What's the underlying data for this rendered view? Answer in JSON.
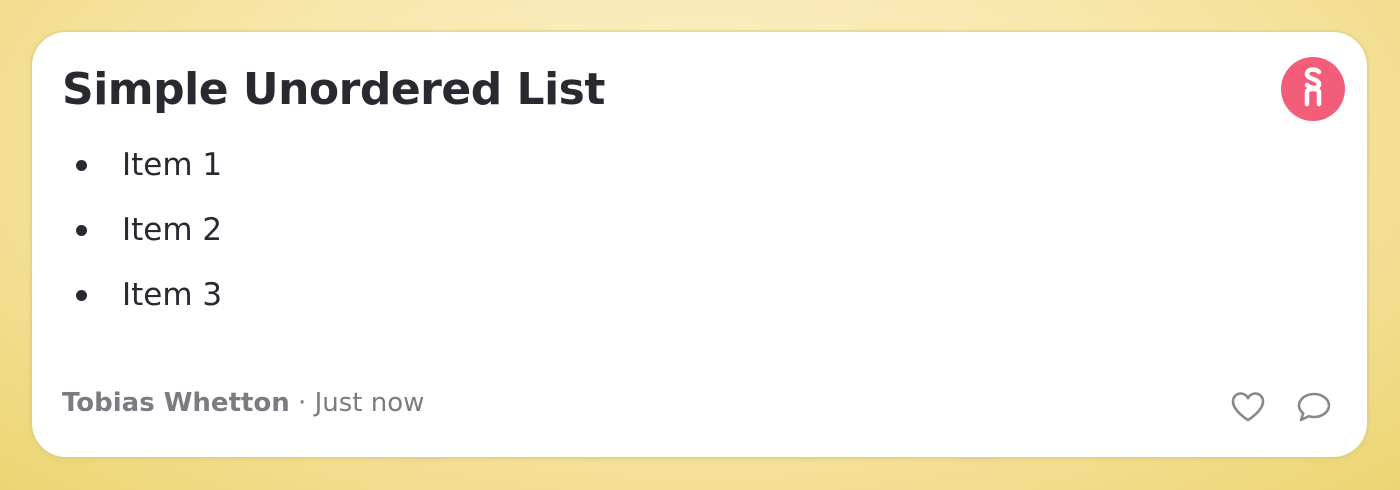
{
  "card": {
    "title": "Simple Unordered List",
    "list_items": [
      {
        "label": "Item 1"
      },
      {
        "label": "Item 2"
      },
      {
        "label": "Item 3"
      }
    ],
    "avatar": {
      "icon": "sn-logo-icon",
      "color": "#f25e7a"
    },
    "footer": {
      "author": "Tobias Whetton",
      "separator": " · ",
      "timestamp": "Just now"
    },
    "actions": {
      "like_icon": "heart-icon",
      "comment_icon": "comment-icon"
    }
  },
  "colors": {
    "text": "#2a2830",
    "muted": "#7d7b82",
    "accent": "#f25e7a"
  }
}
